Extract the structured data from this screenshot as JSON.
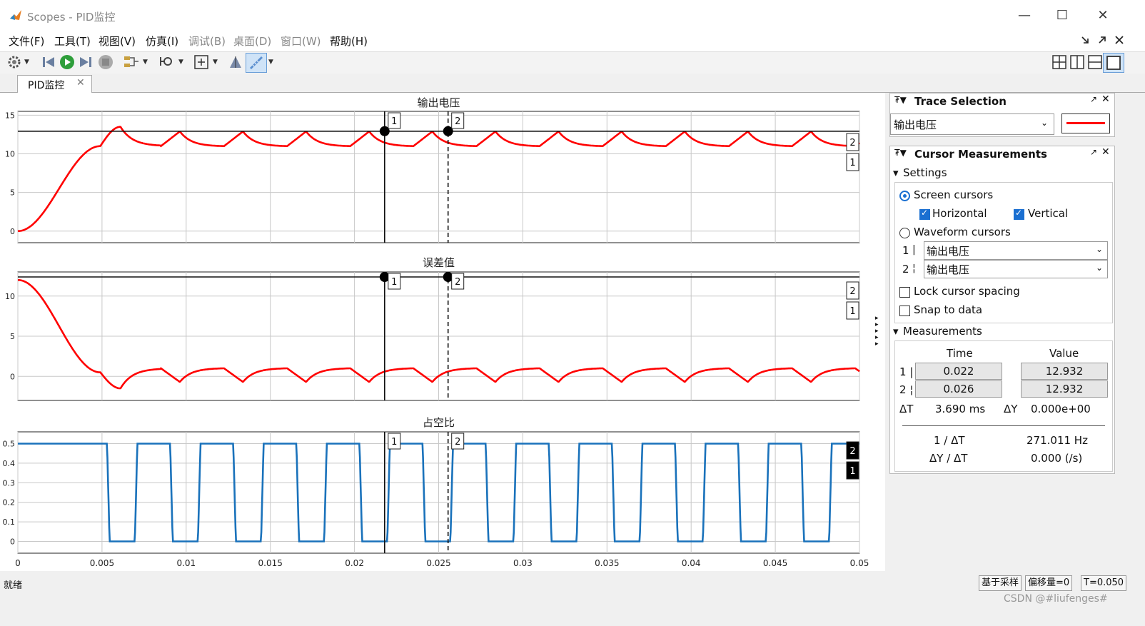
{
  "window": {
    "title": "Scopes - PID监控",
    "minimize_glyph": "—",
    "maximize_glyph": "☐",
    "close_glyph": "✕"
  },
  "menu": {
    "items": [
      {
        "label": "文件(F)",
        "enabled": true
      },
      {
        "label": "工具(T)",
        "enabled": true
      },
      {
        "label": "视图(V)",
        "enabled": true
      },
      {
        "label": "仿真(I)",
        "enabled": true
      },
      {
        "label": "调试(B)",
        "enabled": false
      },
      {
        "label": "桌面(D)",
        "enabled": false
      },
      {
        "label": "窗口(W)",
        "enabled": false
      },
      {
        "label": "帮助(H)",
        "enabled": true
      }
    ],
    "right_icons": [
      "dock-icon",
      "undock-icon",
      "close-icon"
    ]
  },
  "toolbar": {
    "icons": [
      "settings-icon",
      "step-back-icon",
      "run-icon",
      "step-forward-icon",
      "stop-icon",
      "signal-icon",
      "zoom-icon",
      "autoscale-icon",
      "highlight-icon",
      "cursor-measure-icon"
    ],
    "layout_icons": [
      "layout-2x2-icon",
      "layout-columns-icon",
      "layout-rows-icon",
      "layout-single-icon"
    ]
  },
  "tab": {
    "label": "PID监控",
    "close_glyph": "✕"
  },
  "plots": {
    "subplot1_title": "输出电压",
    "subplot2_title": "误差值",
    "subplot3_title": "占空比",
    "cursor1_label": "1",
    "cursor2_label": "2",
    "x_ticks": [
      "0",
      "0.005",
      "0.01",
      "0.015",
      "0.02",
      "0.025",
      "0.03",
      "0.035",
      "0.04",
      "0.045",
      "0.05"
    ],
    "y1_ticks": [
      "15",
      "10",
      "5",
      "0"
    ],
    "y2_ticks": [
      "10",
      "5",
      "0"
    ],
    "y3_ticks": [
      "0.5",
      "0.4",
      "0.3",
      "0.2",
      "0.1",
      "0"
    ]
  },
  "chart_data": [
    {
      "type": "line",
      "title": "输出电压",
      "xlim": [
        0,
        0.05
      ],
      "ylim": [
        -1.5,
        15.5
      ],
      "grid": true,
      "series": [
        {
          "color": "#ff0000",
          "rise_end_x": 0.005,
          "overshoot_peak": 13.5,
          "ripple_min": 11.0,
          "ripple_max": 12.9,
          "ripple_period": 0.00375
        }
      ],
      "cursors": {
        "vertical_1_x": 0.022,
        "vertical_2_x": 0.026,
        "horizontal_y": 12.932
      }
    },
    {
      "type": "line",
      "title": "误差值",
      "xlim": [
        0,
        0.05
      ],
      "ylim": [
        -3,
        13
      ],
      "grid": true,
      "series": [
        {
          "color": "#ff0000",
          "start_value": 12.0,
          "undershoot_min": -1.5,
          "ripple_min": -0.7,
          "ripple_max": 1.0,
          "ripple_period": 0.00375
        }
      ],
      "cursors": {
        "vertical_1_x": 0.022,
        "vertical_2_x": 0.026,
        "horizontal_y": 12.932
      }
    },
    {
      "type": "line",
      "title": "占空比",
      "xlim": [
        0,
        0.05
      ],
      "ylim": [
        -0.06,
        0.56
      ],
      "grid": true,
      "series": [
        {
          "color": "#1a72bb",
          "high": 0.5,
          "low": 0.0,
          "first_drop_x": 0.0053,
          "period": 0.00375,
          "duty": 0.52
        }
      ],
      "cursors": {
        "vertical_1_x": 0.022,
        "vertical_2_x": 0.026
      }
    }
  ],
  "side": {
    "trace_selection": {
      "title": "Trace Selection",
      "selected_signal": "输出电压",
      "line_color": "#ff0000"
    },
    "cursor_measurements": {
      "title": "Cursor Measurements",
      "settings_label": "Settings",
      "screen_cursors": "Screen cursors",
      "horizontal": "Horizontal",
      "vertical": "Vertical",
      "waveform_cursors": "Waveform cursors",
      "cursor1_signal": "输出电压",
      "cursor2_signal": "输出电压",
      "cursor1_num": "1",
      "cursor2_num": "2",
      "lock_spacing": "Lock cursor spacing",
      "snap_to_data": "Snap to data",
      "measurements_label": "Measurements",
      "col_time": "Time",
      "col_value": "Value",
      "row1_time": "0.022",
      "row1_value": "12.932",
      "row2_time": "0.026",
      "row2_value": "12.932",
      "delta_t_label": "ΔT",
      "delta_t_value": "3.690 ms",
      "delta_y_label": "ΔY",
      "delta_y_value": "0.000e+00",
      "inv_dt_label": "1 / ΔT",
      "inv_dt_value": "271.011 Hz",
      "dy_dt_label": "ΔY / ΔT",
      "dy_dt_value": "0.000 (/s)"
    }
  },
  "status": {
    "ready": "就绪",
    "mode": "基于采样",
    "offset": "偏移量=0",
    "time": "T=0.050",
    "watermark": "CSDN @#liufenges#"
  }
}
